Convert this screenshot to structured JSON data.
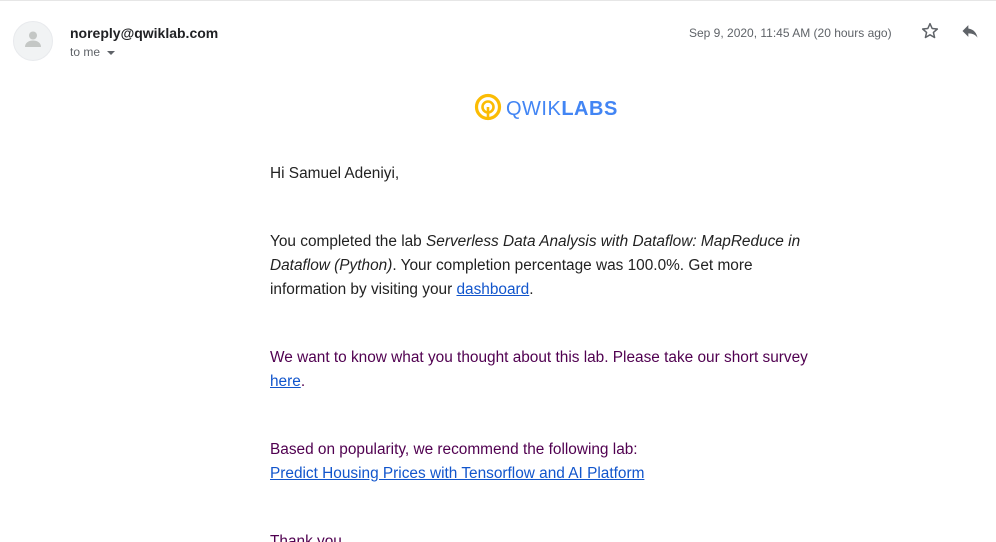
{
  "header": {
    "sender": "noreply@qwiklab.com",
    "recipient_label": "to me",
    "date": "Sep 9, 2020, 11:45 AM (20 hours ago)"
  },
  "icons": {
    "avatar": "person-icon",
    "star": "star-icon",
    "reply": "reply-icon",
    "caret": "caret-down-icon",
    "logo": "qwiklabs-logo-icon"
  },
  "logo": {
    "text_light": "QWIK",
    "text_bold": "LABS",
    "accent_color": "#fbbc04",
    "text_color": "#4285f4"
  },
  "message": {
    "greeting": "Hi Samuel Adeniyi,",
    "p1_before": "You completed the lab ",
    "p1_lab_title": "Serverless Data Analysis with Dataflow: MapReduce in Dataflow (Python)",
    "p1_after": ". Your completion percentage was 100.0%. Get more information by visiting your ",
    "p1_link": "dashboard",
    "p1_end": ".",
    "p2_before": "We want to know what you thought about this lab. Please take our short survey ",
    "p2_link": "here",
    "p2_end": ".",
    "p3_text": "Based on popularity, we recommend the following lab:",
    "p3_link": "Predict Housing Prices with Tensorflow and AI Platform",
    "closing": "Thank you"
  }
}
